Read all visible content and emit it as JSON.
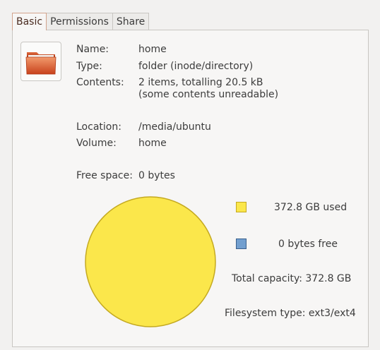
{
  "tabs": [
    "Basic",
    "Permissions",
    "Share"
  ],
  "info": {
    "name_label": "Name:",
    "name_value": "home",
    "type_label": "Type:",
    "type_value": "folder (inode/directory)",
    "contents_label": "Contents:",
    "contents_value_line1": "2 items, totalling 20.5 kB",
    "contents_value_line2": "(some contents unreadable)",
    "location_label": "Location:",
    "location_value": "/media/ubuntu",
    "volume_label": "Volume:",
    "volume_value": "home",
    "free_space_label": "Free space:",
    "free_space_value": "0 bytes"
  },
  "usage": {
    "used_label": "372.8 GB used",
    "free_label": "0 bytes free",
    "total_capacity": "Total capacity: 372.8 GB",
    "filesystem_type": "Filesystem type: ext3/ext4",
    "used_color": "#fbe74b",
    "used_border": "#c4a920",
    "free_color": "#729fcf",
    "free_border": "#3a5f8c"
  },
  "icons": {
    "folder": "folder-icon"
  }
}
